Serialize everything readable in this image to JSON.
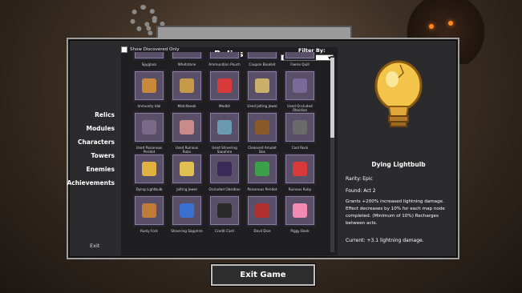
{
  "menu": {
    "items": [
      {
        "label": "Relics"
      },
      {
        "label": "Modules"
      },
      {
        "label": "Characters"
      },
      {
        "label": "Towers"
      },
      {
        "label": "Enemies"
      },
      {
        "label": "Achievements"
      }
    ],
    "exit_label": "Exit"
  },
  "relics": {
    "title": "Relics",
    "show_discovered_label": "Show Discovered Only",
    "filter_label": "Filter By:",
    "filter_value": "Default",
    "items": [
      {
        "name": "Spyglass",
        "icon": "spyglass-icon",
        "color": "#b88a3a"
      },
      {
        "name": "Whetstone",
        "icon": "whetstone-icon",
        "color": "#8e8e8e"
      },
      {
        "name": "Ammunition Pouch",
        "icon": "pouch-icon",
        "color": "#7a5a3a"
      },
      {
        "name": "Coupon Booklet",
        "icon": "booklet-icon",
        "color": "#6aa84f"
      },
      {
        "name": "Faerie Quill",
        "icon": "quill-icon",
        "color": "#c05a8a"
      },
      {
        "name": "Immunity Idol",
        "icon": "idol-icon",
        "color": "#c88a3a"
      },
      {
        "name": "Matchbook",
        "icon": "matchbook-icon",
        "color": "#c79a4a"
      },
      {
        "name": "Medkit",
        "icon": "medkit-icon",
        "color": "#d83a3a"
      },
      {
        "name": "Used Jolting Jewel",
        "icon": "jewel-icon",
        "color": "#c9b16a"
      },
      {
        "name": "Used Occluded Obsidian",
        "icon": "obsidian-icon",
        "color": "#7a6a9a"
      },
      {
        "name": "Used Poisonous Peridot",
        "icon": "peridot-icon",
        "color": "#7a6a8a"
      },
      {
        "name": "Used Ruinous Ruby",
        "icon": "ruby-icon",
        "color": "#c98a8a"
      },
      {
        "name": "Used Shivering Sapphire",
        "icon": "sapphire-icon",
        "color": "#6a9ab0"
      },
      {
        "name": "Cleansed Amulet Box",
        "icon": "chest-icon",
        "color": "#8a5a2a"
      },
      {
        "name": "Cool Rock",
        "icon": "rock-icon",
        "color": "#6a6a6a"
      },
      {
        "name": "Dying Lightbulb",
        "icon": "lightbulb-icon",
        "color": "#e0b040"
      },
      {
        "name": "Jolting Jewel",
        "icon": "jewel-icon",
        "color": "#e0c050"
      },
      {
        "name": "Occluded Obsidian",
        "icon": "obsidian-icon",
        "color": "#3a2a5a"
      },
      {
        "name": "Poisonous Peridot",
        "icon": "peridot-icon",
        "color": "#3aa04a"
      },
      {
        "name": "Ruinous Ruby",
        "icon": "ruby-icon",
        "color": "#d83a3a"
      },
      {
        "name": "Rusty Fork",
        "icon": "fork-icon",
        "color": "#c07a3a"
      },
      {
        "name": "Shivering Sapphire",
        "icon": "sapphire-icon",
        "color": "#3a70d0"
      },
      {
        "name": "Credit Card",
        "icon": "credit-card-icon",
        "color": "#2a2a2a"
      },
      {
        "name": "Devil Dice",
        "icon": "dice-icon",
        "color": "#b03030"
      },
      {
        "name": "Piggy Bank",
        "icon": "piggy-bank-icon",
        "color": "#f08ab0"
      }
    ]
  },
  "detail": {
    "name": "Dying Lightbulb",
    "rarity": "Rarity: Epic",
    "found": "Found: Act 2",
    "description": "Grants +200% increased lightning damage. Effect decreases by 10% for each map node completed. (Minimum of 10%) Recharges between acts.",
    "current": "Current: +3.1 lightning damage."
  },
  "exit_game_label": "Exit Game"
}
